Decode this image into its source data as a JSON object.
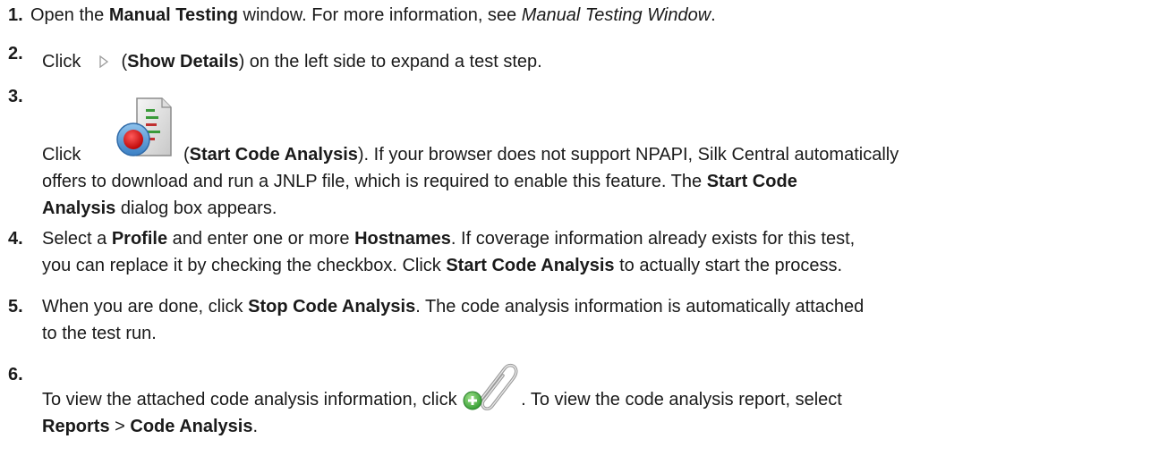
{
  "steps": [
    {
      "number": "1.",
      "parts": {
        "a": "Open the ",
        "b": "Manual Testing",
        "c": " window. For more information, see ",
        "d": "Manual Testing Window",
        "e": "."
      }
    },
    {
      "number": "2.",
      "parts": {
        "a": "Click ",
        "icon": "show-details-triangle-icon",
        "b": " (",
        "c": "Show Details",
        "d": ") on the left side to expand a test step."
      }
    },
    {
      "number": "3.",
      "parts": {
        "a": "Click ",
        "icon": "start-code-analysis-icon",
        "b": " (",
        "c": "Start Code Analysis",
        "d": "). If your browser does not support NPAPI, Silk Central automatically",
        "e": "offers to download and run a JNLP file, which is required to enable this feature. The ",
        "f": "Start Code",
        "g": "Analysis",
        "h": " dialog box appears."
      }
    },
    {
      "number": "4.",
      "parts": {
        "a": "Select a ",
        "b": "Profile",
        "c": " and enter one or more ",
        "d": "Hostnames",
        "e": ". If coverage information already exists for this test,",
        "f": "you can replace it by checking the checkbox. Click ",
        "g": "Start Code Analysis",
        "h": " to actually start the process."
      }
    },
    {
      "number": "5.",
      "parts": {
        "a": "When you are done, click ",
        "b": "Stop Code Analysis",
        "c": ". The code analysis information is automatically attached",
        "d": "to the test run."
      }
    },
    {
      "number": "6.",
      "parts": {
        "a": "To view the attached code analysis information, click ",
        "icon": "paperclip-add-icon",
        "b": ". To view the code analysis report, select",
        "c": "Reports",
        "d": " > ",
        "e": "Code Analysis",
        "f": "."
      }
    }
  ]
}
